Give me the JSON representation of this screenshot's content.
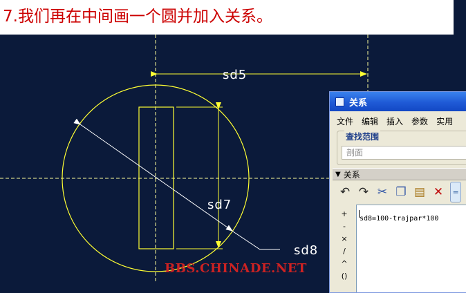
{
  "caption": "7.我们再在中间画一个圆并加入关系。",
  "sketch": {
    "dimensions": {
      "top": "sd5",
      "vertical": "sd7",
      "diagonal": "sd8"
    },
    "colors": {
      "background": "#0b1a3a",
      "geometry": "#ffff33",
      "dimension": "#ffffff",
      "centerline": "#ffff99"
    }
  },
  "watermark": "BBS.CHINADE.NET",
  "dialog": {
    "title": "关系",
    "menu": [
      "文件",
      "编辑",
      "插入",
      "参数",
      "实用"
    ],
    "lookup": {
      "label": "查找范围",
      "value": "剖面"
    },
    "section_label": "关系",
    "toolbar_icons": [
      "undo-icon",
      "redo-icon",
      "cut-icon",
      "copy-icon",
      "paste-icon",
      "delete-icon",
      "evaluate-icon"
    ],
    "operators": [
      "+",
      "-",
      "×",
      "/",
      "^",
      "()"
    ],
    "relation_text": "sd8=100-trajpar*100"
  }
}
